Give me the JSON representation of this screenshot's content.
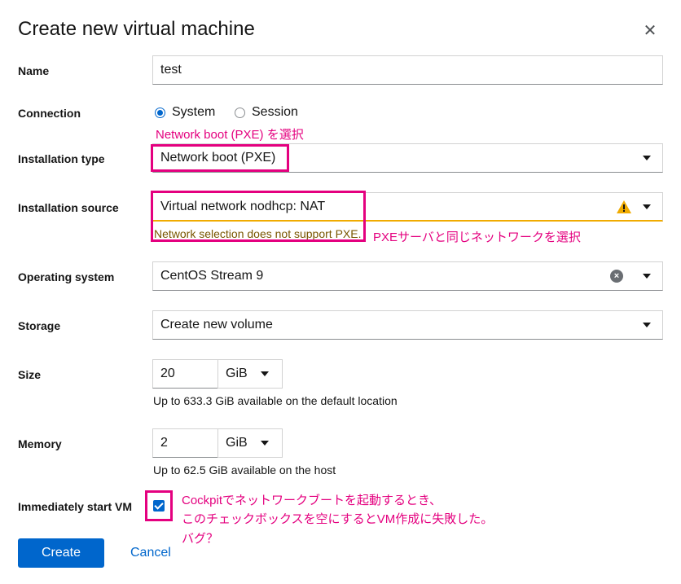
{
  "dialog": {
    "title": "Create new virtual machine",
    "close_glyph": "✕"
  },
  "form": {
    "name": {
      "label": "Name",
      "value": "test"
    },
    "connection": {
      "label": "Connection",
      "options": [
        {
          "label": "System",
          "selected": true
        },
        {
          "label": "Session",
          "selected": false
        }
      ]
    },
    "installation_type": {
      "label": "Installation type",
      "value": "Network boot (PXE)"
    },
    "installation_source": {
      "label": "Installation source",
      "value": "Virtual network nodhcp: NAT",
      "warning": "Network selection does not support PXE.",
      "warning_icon": "warning-triangle-icon"
    },
    "operating_system": {
      "label": "Operating system",
      "value": "CentOS Stream 9",
      "clear_icon": "clear-icon"
    },
    "storage": {
      "label": "Storage",
      "value": "Create new volume"
    },
    "size": {
      "label": "Size",
      "value": "20",
      "unit": "GiB",
      "helper": "Up to 633.3 GiB available on the default location"
    },
    "memory": {
      "label": "Memory",
      "value": "2",
      "unit": "GiB",
      "helper": "Up to 62.5 GiB available on the host"
    },
    "start_vm": {
      "label": "Immediately start VM",
      "checked": true
    }
  },
  "actions": {
    "create": "Create",
    "cancel": "Cancel"
  },
  "annotations": {
    "install_type_note": "Network boot (PXE) を選択",
    "source_note": "PXEサーバと同じネットワークを選択",
    "checkbox_note_1": "Cockpitでネットワークブートを起動するとき、",
    "checkbox_note_2": "このチェックボックスを空にするとVM作成に失敗した。",
    "checkbox_note_3": "バグ？"
  },
  "colors": {
    "primary": "#0066cc",
    "annotation": "#e4007f",
    "warning": "#f0ab00",
    "warning_text": "#795600"
  }
}
